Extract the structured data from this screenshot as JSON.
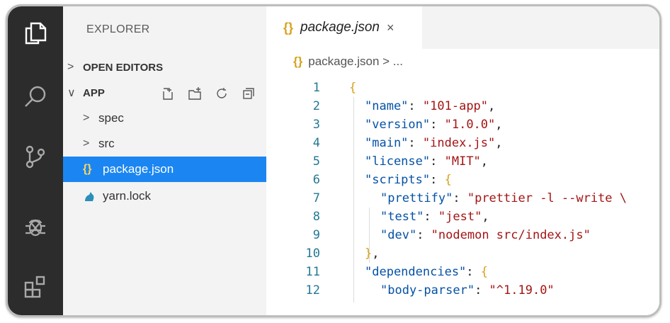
{
  "sidebar": {
    "title": "EXPLORER",
    "open_editors": {
      "chevron": ">",
      "label": "OPEN EDITORS"
    },
    "app": {
      "chevron": "∨",
      "label": "APP"
    },
    "items": [
      {
        "chevron": ">",
        "label": "spec"
      },
      {
        "chevron": ">",
        "label": "src"
      },
      {
        "icon": "{}",
        "label": "package.json"
      },
      {
        "label": "yarn.lock"
      }
    ]
  },
  "tab": {
    "braces": "{}",
    "name": "package.json",
    "close": "×"
  },
  "breadcrumb": {
    "braces": "{}",
    "path": "package.json > ..."
  },
  "colors": {
    "selected": "#1b86f2",
    "activity_bar": "#2c2c2c",
    "json_key": "#0451a5",
    "json_string": "#a31515"
  },
  "code": {
    "line_numbers": [
      "1",
      "2",
      "3",
      "4",
      "5",
      "6",
      "7",
      "8",
      "9",
      "10",
      "11",
      "12"
    ],
    "lines": [
      {
        "p1": "{"
      },
      {
        "k": "\"name\"",
        "p": ": ",
        "s": "\"101-app\"",
        "e": ","
      },
      {
        "k": "\"version\"",
        "p": ": ",
        "s": "\"1.0.0\"",
        "e": ","
      },
      {
        "k": "\"main\"",
        "p": ": ",
        "s": "\"index.js\"",
        "e": ","
      },
      {
        "k": "\"license\"",
        "p": ": ",
        "s": "\"MIT\"",
        "e": ","
      },
      {
        "k": "\"scripts\"",
        "p": ": ",
        "b": "{"
      },
      {
        "k": "\"prettify\"",
        "p": ": ",
        "s": "\"prettier -l --write \\"
      },
      {
        "k": "\"test\"",
        "p": ": ",
        "s": "\"jest\"",
        "e": ","
      },
      {
        "k": "\"dev\"",
        "p": ": ",
        "s": "\"nodemon src/index.js\""
      },
      {
        "b": "}",
        "e": ","
      },
      {
        "k": "\"dependencies\"",
        "p": ": ",
        "b": "{"
      },
      {
        "k": "\"body-parser\"",
        "p": ": ",
        "s": "\"^1.19.0\""
      }
    ]
  }
}
